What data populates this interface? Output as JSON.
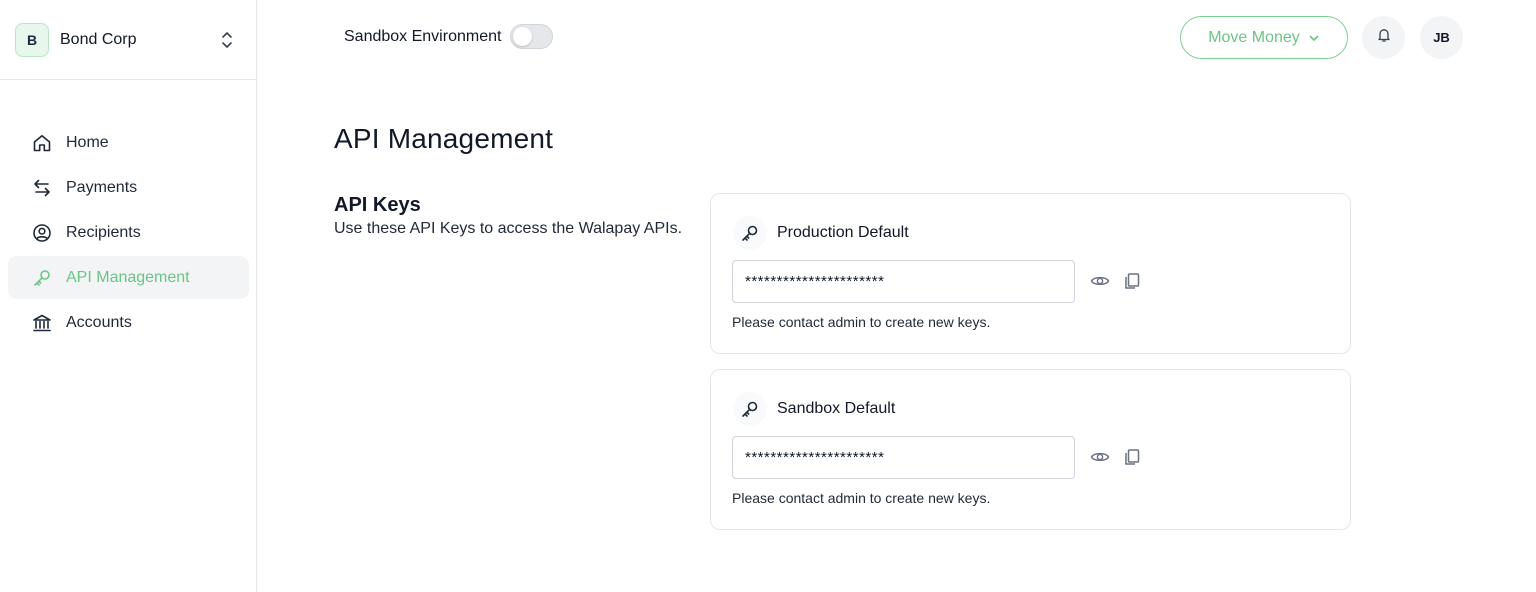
{
  "org": {
    "initial": "B",
    "name": "Bond Corp"
  },
  "sidebar": {
    "items": [
      {
        "label": "Home",
        "icon": "home-icon"
      },
      {
        "label": "Payments",
        "icon": "transfer-arrows-icon"
      },
      {
        "label": "Recipients",
        "icon": "user-circle-icon"
      },
      {
        "label": "API Management",
        "icon": "key-icon",
        "active": true
      },
      {
        "label": "Accounts",
        "icon": "bank-icon"
      }
    ]
  },
  "header": {
    "sandbox_label": "Sandbox Environment",
    "sandbox_enabled": false,
    "move_money_label": "Move Money",
    "user_initials": "JB"
  },
  "main": {
    "title": "API Management",
    "section_title": "API Keys",
    "section_desc": "Use these API Keys to access the Walapay APIs.",
    "keys": [
      {
        "name": "Production Default",
        "value": "**********************",
        "note": "Please contact admin to create new keys."
      },
      {
        "name": "Sandbox Default",
        "value": "**********************",
        "note": "Please contact admin to create new keys."
      }
    ]
  },
  "colors": {
    "accent": "#6cc486",
    "active_bg": "#f3f4f6",
    "border": "#e5e7eb"
  }
}
